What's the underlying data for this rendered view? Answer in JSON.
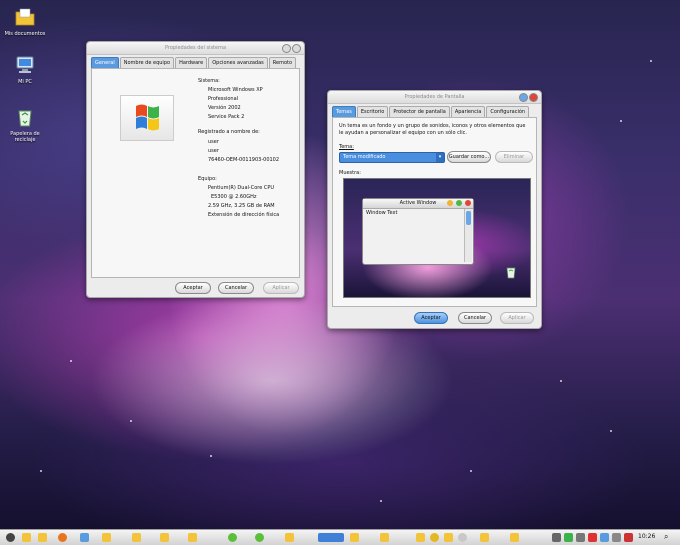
{
  "desktop": {
    "icons": [
      {
        "label": "Mis documentos"
      },
      {
        "label": "Mi PC"
      },
      {
        "label": "Papelera de reciclaje"
      }
    ]
  },
  "system_properties": {
    "title": "Propiedades del sistema",
    "tabs": [
      {
        "label": "General",
        "active": true
      },
      {
        "label": "Nombre de equipo"
      },
      {
        "label": "Hardware"
      },
      {
        "label": "Opciones avanzadas"
      },
      {
        "label": "Remoto"
      }
    ],
    "system_heading": "Sistema:",
    "os_name": "Microsoft Windows XP",
    "edition": "Professional",
    "version": "Versión 2002",
    "service_pack": "Service Pack 2",
    "registered_heading": "Registrado a nombre de:",
    "user1": "user",
    "user2": "user",
    "product_id": "76460-OEM-0011903-00102",
    "equipo_heading": "Equipo:",
    "cpu": "Pentium(R) Dual-Core  CPU",
    "cpu_model": "E5300  @ 2.60GHz",
    "ram": "2.59 GHz, 3.25 GB de RAM",
    "pae": "Extensión de dirección física",
    "buttons": {
      "ok": "Aceptar",
      "cancel": "Cancelar",
      "apply": "Aplicar"
    }
  },
  "display_properties": {
    "title": "Propiedades de Pantalla",
    "tabs": [
      {
        "label": "Temas",
        "active": true
      },
      {
        "label": "Escritorio"
      },
      {
        "label": "Protector de pantalla"
      },
      {
        "label": "Apariencia"
      },
      {
        "label": "Configuración"
      }
    ],
    "description": "Un tema es un fondo y un grupo de sonidos, iconos y otros elementos que le ayudan a personalizar el equipo con un sólo clic.",
    "theme_label": "Tema:",
    "theme_value": "Tema modificado",
    "save_as": "Guardar como...",
    "delete": "Eliminar",
    "sample_label": "Muestra:",
    "preview_window_title": "Active Window",
    "preview_window_text": "Window Text",
    "buttons": {
      "ok": "Aceptar",
      "cancel": "Cancelar",
      "apply": "Aplicar"
    }
  },
  "taskbar": {
    "clock": "10:26"
  },
  "colors": {
    "accent": "#5a9be0",
    "folder": "#f3c33a"
  }
}
